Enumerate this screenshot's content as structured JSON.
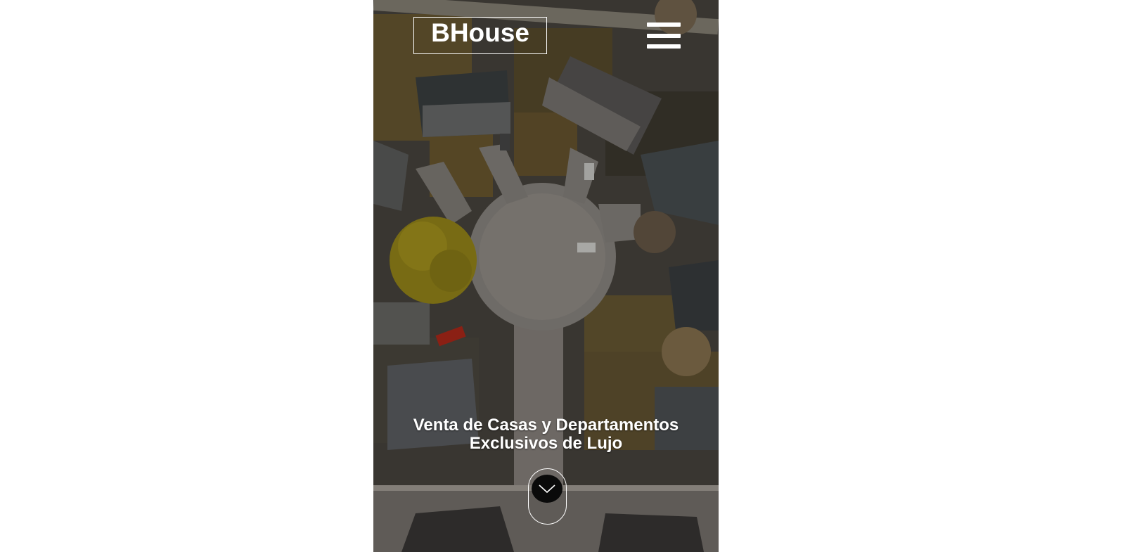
{
  "header": {
    "brand": "BHouse",
    "menu_icon": "hamburger-menu-icon"
  },
  "hero": {
    "title_line1": "Venta de Casas y Departamentos",
    "title_line2": "Exclusivos de Lujo",
    "scroll_icon": "chevron-down-icon",
    "background": "aerial-neighborhood-cul-de-sac"
  },
  "colors": {
    "text": "#ffffff",
    "scroll_button": "#0a0a0a",
    "overlay": "#3d3a35"
  }
}
